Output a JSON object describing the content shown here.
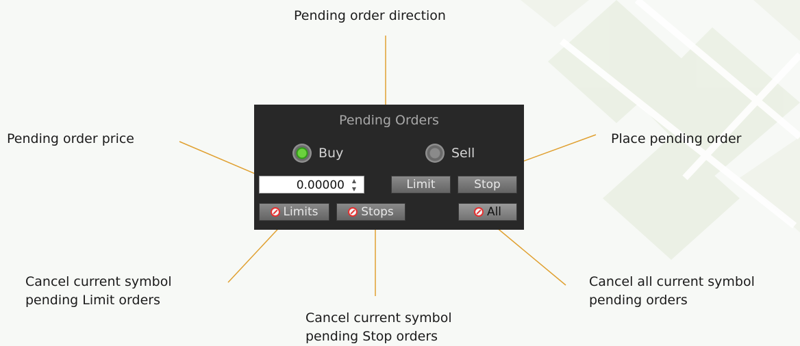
{
  "annotations": {
    "direction": "Pending order direction",
    "price": "Pending order price",
    "place": "Place pending order",
    "cancel_limits_line1": "Cancel current symbol",
    "cancel_limits_line2": "pending Limit orders",
    "cancel_stops_line1": "Cancel current symbol",
    "cancel_stops_line2": "pending Stop orders",
    "cancel_all_line1": "Cancel all current symbol",
    "cancel_all_line2": "pending orders"
  },
  "panel": {
    "title": "Pending Orders",
    "buy_label": "Buy",
    "sell_label": "Sell",
    "buy_selected": true,
    "price_value": "0.00000",
    "limit_label": "Limit",
    "stop_label": "Stop",
    "cancel_limits_label": "Limits",
    "cancel_stops_label": "Stops",
    "cancel_all_label": "All"
  },
  "icons": {
    "cancel": "no-entry-icon",
    "spinner": "spinner-arrows-icon",
    "radio_on": "radio-selected-icon",
    "radio_off": "radio-unselected-icon"
  },
  "colors": {
    "panel_bg": "#282828",
    "annotation_line": "#e0a030",
    "radio_on": "#4cc22a",
    "cancel_icon": "#e53030"
  }
}
